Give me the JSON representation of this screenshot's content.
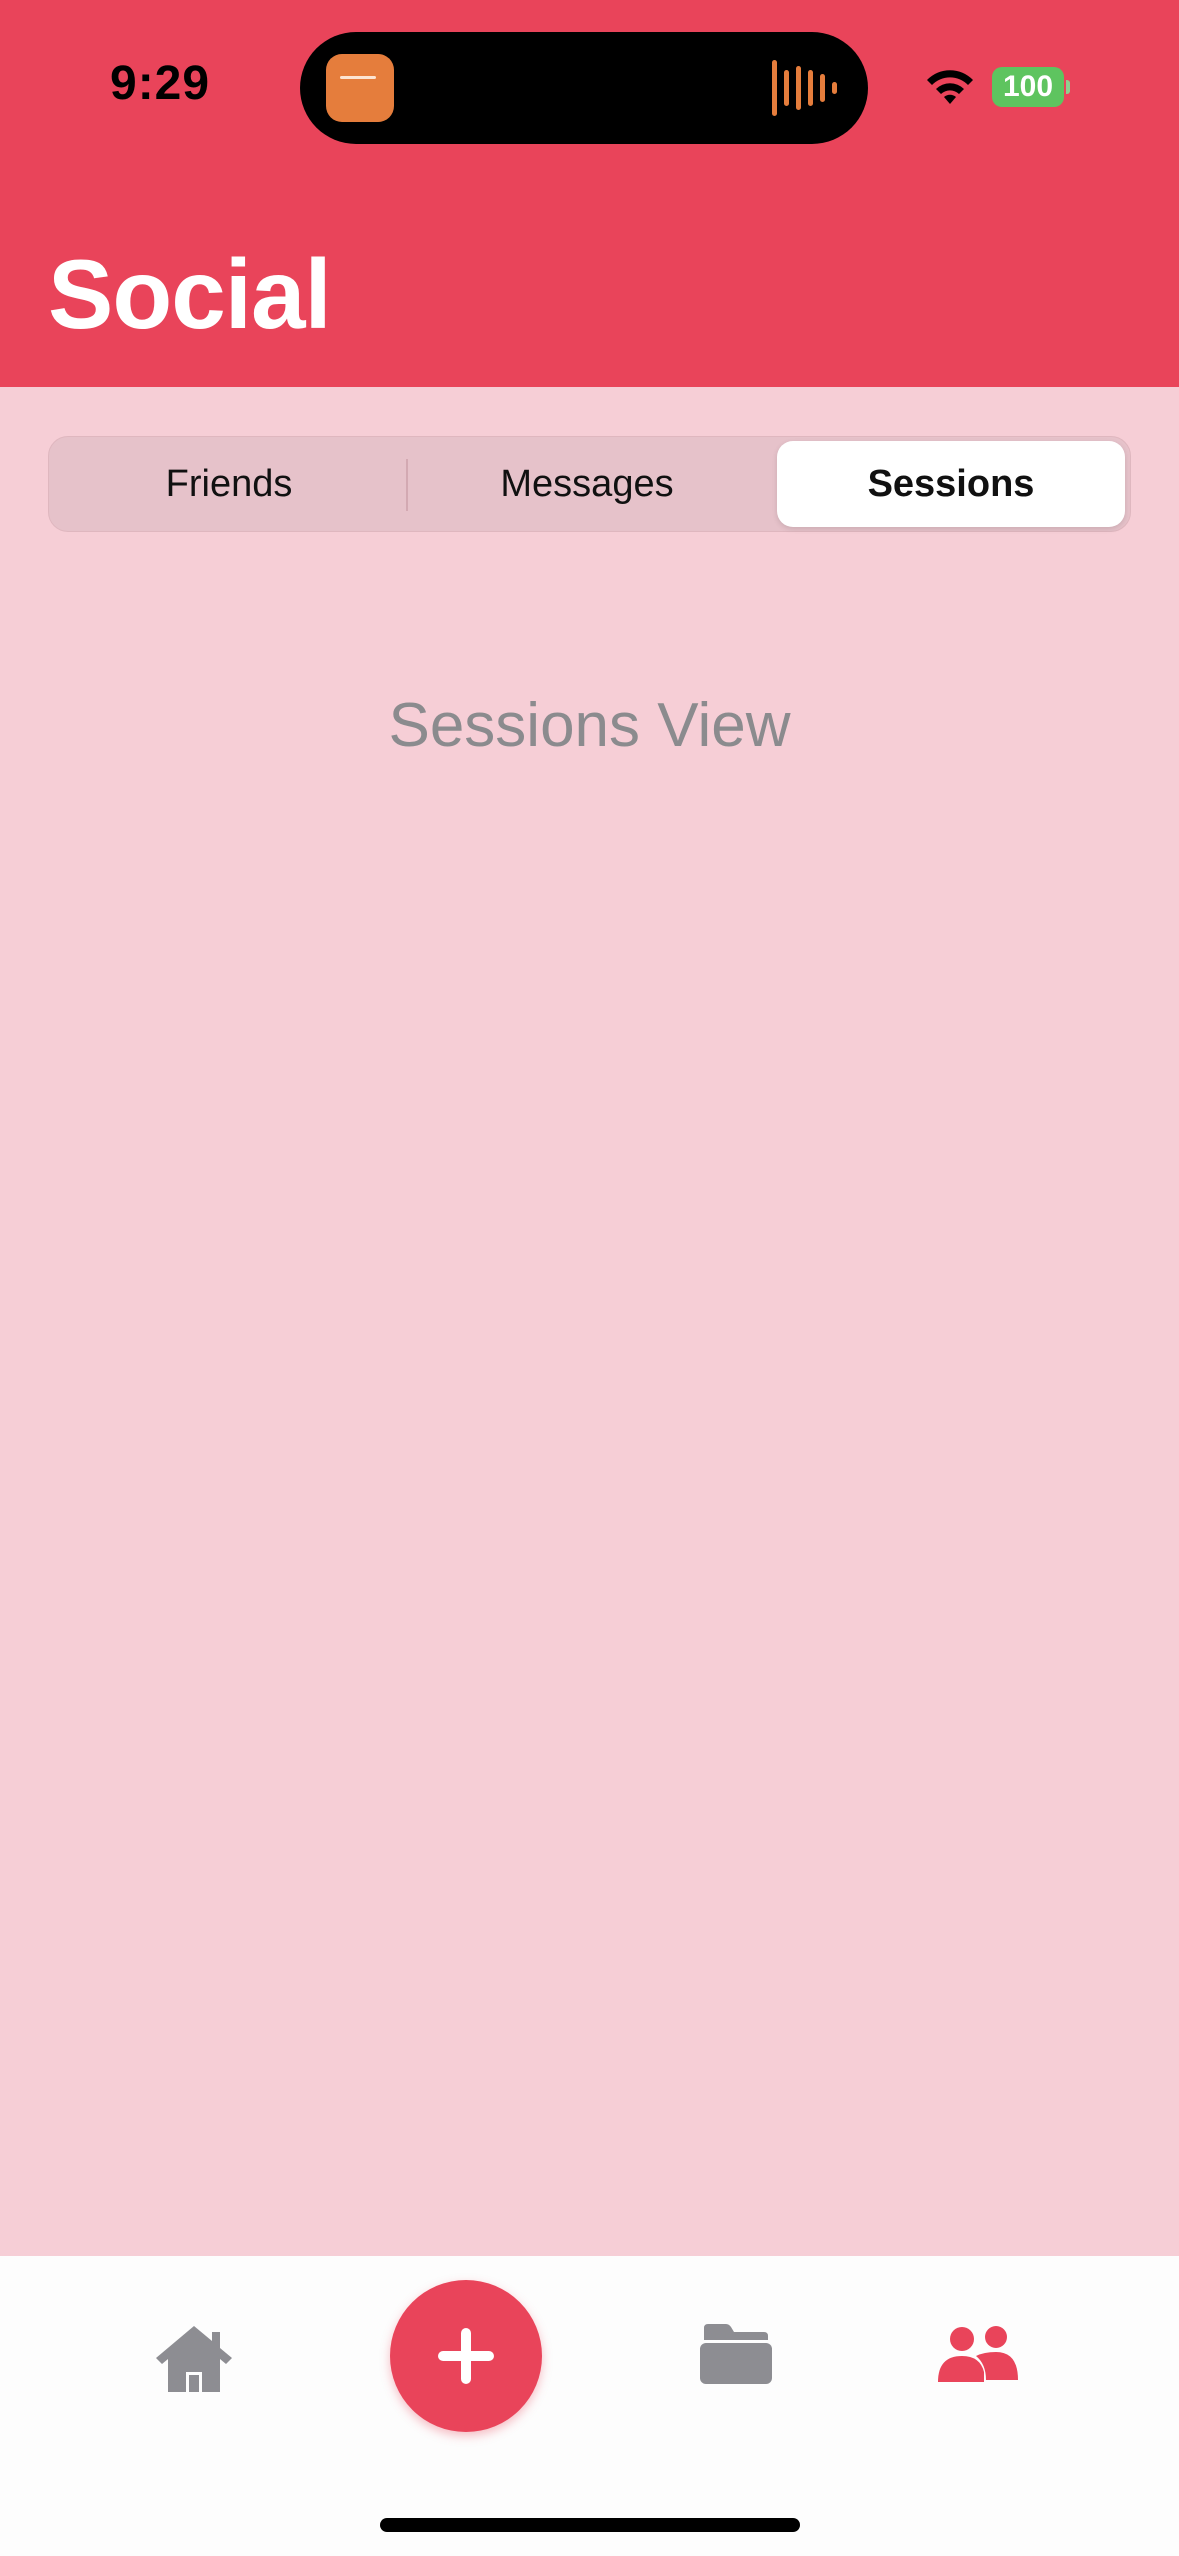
{
  "status_bar": {
    "time": "9:29",
    "battery": "100"
  },
  "header": {
    "title": "Social"
  },
  "segmented_control": {
    "segments": [
      {
        "label": "Friends",
        "selected": false
      },
      {
        "label": "Messages",
        "selected": false
      },
      {
        "label": "Sessions",
        "selected": true
      }
    ]
  },
  "content": {
    "placeholder": "Sessions View"
  },
  "tab_bar": {
    "items": [
      {
        "icon": "house-icon",
        "active": false
      },
      {
        "icon": "plus-icon",
        "active": false
      },
      {
        "icon": "folder-icon",
        "active": false
      },
      {
        "icon": "people-icon",
        "active": true
      }
    ]
  },
  "colors": {
    "accent": "#e9445a",
    "background": "#f6ced6",
    "inactive_icon": "#8d8d92",
    "battery_green": "#5ec45f"
  }
}
